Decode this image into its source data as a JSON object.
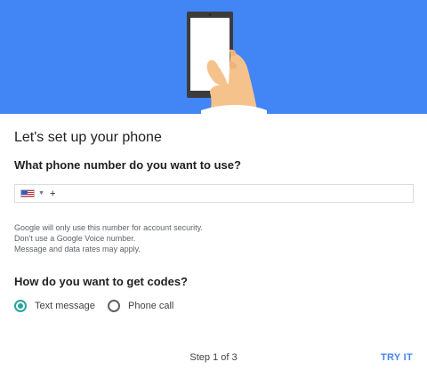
{
  "hero": {
    "illustration": "hand-holding-phone",
    "background_color": "#4285f4"
  },
  "title": "Let's set up your phone",
  "phone_question": "What phone number do you want to use?",
  "phone_field": {
    "country_flag": "us-flag-icon",
    "prefix": "+",
    "value": "",
    "placeholder": ""
  },
  "helper_lines": [
    "Google will only use this number for account security.",
    "Don't use a Google Voice number.",
    "Message and data rates may apply."
  ],
  "codes_question": "How do you want to get codes?",
  "code_options": [
    {
      "label": "Text message",
      "selected": true
    },
    {
      "label": "Phone call",
      "selected": false
    }
  ],
  "footer": {
    "step": "Step 1 of 3",
    "action": "TRY IT",
    "action_color": "#4285f4"
  },
  "accent_color": "#26a69a"
}
